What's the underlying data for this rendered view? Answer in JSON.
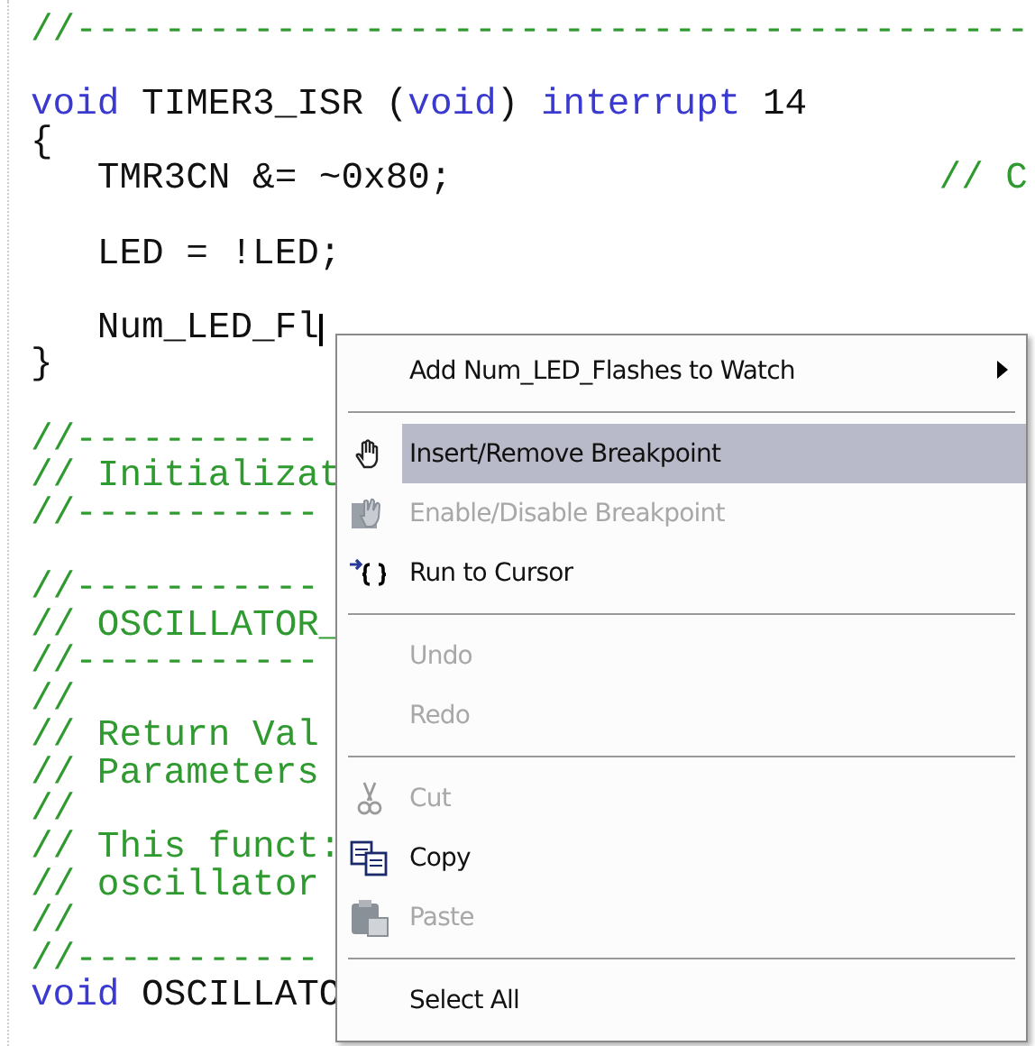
{
  "editor": {
    "lines": [
      {
        "kind": "code",
        "cursor": false,
        "segments": [
          {
            "kind": "comment",
            "text": "//-------------------------------------------"
          }
        ]
      },
      {
        "kind": "blank"
      },
      {
        "kind": "code",
        "cursor": false,
        "segments": [
          {
            "kind": "keyword",
            "text": "void"
          },
          {
            "kind": "plain",
            "text": " TIMER3_ISR ("
          },
          {
            "kind": "keyword",
            "text": "void"
          },
          {
            "kind": "plain",
            "text": ") "
          },
          {
            "kind": "keyword",
            "text": "interrupt"
          },
          {
            "kind": "plain",
            "text": " 14"
          }
        ]
      },
      {
        "kind": "code",
        "cursor": false,
        "segments": [
          {
            "kind": "plain",
            "text": "{"
          }
        ]
      },
      {
        "kind": "code",
        "cursor": false,
        "segments": [
          {
            "kind": "plain",
            "text": "   TMR3CN &= ~0x80;"
          }
        ],
        "trailing_comment": "// C"
      },
      {
        "kind": "blank"
      },
      {
        "kind": "code",
        "cursor": false,
        "segments": [
          {
            "kind": "plain",
            "text": "   LED = !LED;"
          }
        ]
      },
      {
        "kind": "blank"
      },
      {
        "kind": "code",
        "cursor": true,
        "segments": [
          {
            "kind": "plain",
            "text": "   Num_LED_Fl"
          }
        ]
      },
      {
        "kind": "code",
        "cursor": false,
        "segments": [
          {
            "kind": "plain",
            "text": "}"
          }
        ]
      },
      {
        "kind": "blank"
      },
      {
        "kind": "code",
        "cursor": false,
        "segments": [
          {
            "kind": "comment",
            "text": "//-----------"
          }
        ]
      },
      {
        "kind": "code",
        "cursor": false,
        "segments": [
          {
            "kind": "comment",
            "text": "// Initializat"
          }
        ]
      },
      {
        "kind": "code",
        "cursor": false,
        "segments": [
          {
            "kind": "comment",
            "text": "//-----------"
          }
        ]
      },
      {
        "kind": "blank"
      },
      {
        "kind": "code",
        "cursor": false,
        "segments": [
          {
            "kind": "comment",
            "text": "//-----------"
          }
        ]
      },
      {
        "kind": "code",
        "cursor": false,
        "segments": [
          {
            "kind": "comment",
            "text": "// OSCILLATOR_"
          }
        ]
      },
      {
        "kind": "code",
        "cursor": false,
        "segments": [
          {
            "kind": "comment",
            "text": "//-----------"
          }
        ]
      },
      {
        "kind": "code",
        "cursor": false,
        "segments": [
          {
            "kind": "comment",
            "text": "//"
          }
        ]
      },
      {
        "kind": "code",
        "cursor": false,
        "segments": [
          {
            "kind": "comment",
            "text": "// Return Val"
          }
        ]
      },
      {
        "kind": "code",
        "cursor": false,
        "segments": [
          {
            "kind": "comment",
            "text": "// Parameters"
          }
        ]
      },
      {
        "kind": "code",
        "cursor": false,
        "segments": [
          {
            "kind": "comment",
            "text": "//"
          }
        ]
      },
      {
        "kind": "code",
        "cursor": false,
        "segments": [
          {
            "kind": "comment",
            "text": "// This funct:"
          }
        ]
      },
      {
        "kind": "code",
        "cursor": false,
        "segments": [
          {
            "kind": "comment",
            "text": "// oscillator"
          }
        ]
      },
      {
        "kind": "code",
        "cursor": false,
        "segments": [
          {
            "kind": "comment",
            "text": "//"
          }
        ]
      },
      {
        "kind": "code",
        "cursor": false,
        "segments": [
          {
            "kind": "comment",
            "text": "//-----------"
          }
        ]
      },
      {
        "kind": "code",
        "cursor": false,
        "segments": [
          {
            "kind": "keyword",
            "text": "void"
          },
          {
            "kind": "plain",
            "text": " OSCILLATO"
          }
        ]
      }
    ]
  },
  "context_menu": {
    "items": [
      {
        "kind": "plain",
        "label": "Add Num_LED_Flashes to Watch",
        "disabled": false,
        "selected": false,
        "submenu": true
      },
      {
        "kind": "separator"
      },
      {
        "kind": "breakpoint",
        "label": "Insert/Remove Breakpoint",
        "disabled": false,
        "selected": true,
        "submenu": false
      },
      {
        "kind": "toggle-breakpoint",
        "label": "Enable/Disable Breakpoint",
        "disabled": true,
        "selected": false,
        "submenu": false
      },
      {
        "kind": "run-to-cursor",
        "label": "Run to Cursor",
        "disabled": false,
        "selected": false,
        "submenu": false
      },
      {
        "kind": "separator"
      },
      {
        "kind": "plain",
        "label": "Undo",
        "disabled": true,
        "selected": false,
        "submenu": false
      },
      {
        "kind": "plain",
        "label": "Redo",
        "disabled": true,
        "selected": false,
        "submenu": false
      },
      {
        "kind": "separator"
      },
      {
        "kind": "cut",
        "label": "Cut",
        "disabled": true,
        "selected": false,
        "submenu": false
      },
      {
        "kind": "copy",
        "label": "Copy",
        "disabled": false,
        "selected": false,
        "submenu": false
      },
      {
        "kind": "paste",
        "label": "Paste",
        "disabled": true,
        "selected": false,
        "submenu": false
      },
      {
        "kind": "separator"
      },
      {
        "kind": "plain",
        "label": "Select All",
        "disabled": false,
        "selected": false,
        "submenu": false
      }
    ]
  }
}
